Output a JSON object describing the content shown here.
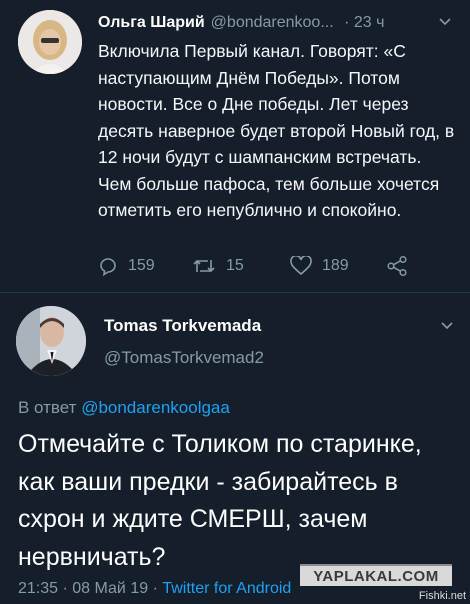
{
  "tweet1": {
    "author_name": "Ольга Шарий",
    "handle": "@bondarenkoo...",
    "time": "23 ч",
    "text": "Включила Первый канал. Говорят: «С наступающим Днём Победы». Потом новости. Все о Дне победы. Лет через десять наверное будет второй Новый год, в 12 ночи будут с шампанским встречать. Чем больше пафоса, тем больше хочется отметить его непублично и спокойно.",
    "replies": "159",
    "retweets": "15",
    "likes": "189",
    "icons": {
      "caret": "chevron-down-icon",
      "reply": "reply-icon",
      "retweet": "retweet-icon",
      "like": "heart-icon",
      "share": "share-icon"
    }
  },
  "tweet2": {
    "author_name": "Tomas Torkvemada",
    "handle": "@TomasTorkvemad2",
    "reply_prefix": "В ответ",
    "reply_handle": "@bondarenkoolgaa",
    "text": "Отмечайте с Толиком по старинке, как ваши предки - забирайтесь в схрон и ждите СМЕРШ, зачем нервничать?",
    "time": "21:35",
    "date": "08 Май 19",
    "source": "Twitter for Android"
  },
  "watermarks": {
    "yaplakal": "YAPLAKAL.COM",
    "fishki": "Fishki.net"
  },
  "colors": {
    "background": "#151f2b",
    "secondary_text": "#8899a6",
    "link": "#1da1f2"
  }
}
